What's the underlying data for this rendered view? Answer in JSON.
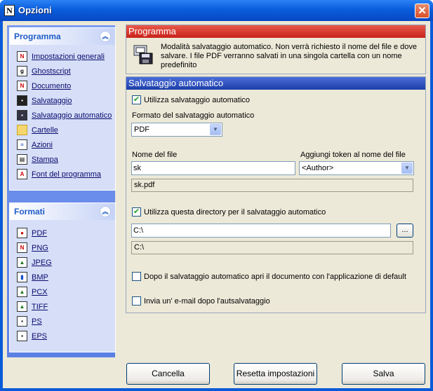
{
  "window": {
    "title": "Opzioni"
  },
  "sidebar": {
    "programma_title": "Programma",
    "programma_items": [
      {
        "label": "Impostazioni generali"
      },
      {
        "label": "Ghostscript"
      },
      {
        "label": "Documento"
      },
      {
        "label": "Salvataggio"
      },
      {
        "label": "Salvataggio automatico"
      },
      {
        "label": "Cartelle"
      },
      {
        "label": "Azioni"
      },
      {
        "label": "Stampa"
      },
      {
        "label": "Font del programma"
      }
    ],
    "formati_title": "Formati",
    "formati_items": [
      {
        "label": "PDF"
      },
      {
        "label": "PNG"
      },
      {
        "label": "JPEG"
      },
      {
        "label": "BMP"
      },
      {
        "label": "PCX"
      },
      {
        "label": "TIFF"
      },
      {
        "label": "PS"
      },
      {
        "label": "EPS"
      }
    ]
  },
  "programma_section": {
    "title": "Programma",
    "description": "Modalità salvataggio automatico. Non verrà richiesto il nome del file e dove salvare. I file PDF verranno salvati in una singola cartella con un nome predefinito"
  },
  "autosave": {
    "title": "Salvataggio automatico",
    "use_autosave_label": "Utilizza salvataggio automatico",
    "use_autosave_checked": true,
    "format_label": "Formato del salvataggio automatico",
    "format_value": "PDF",
    "filename_label": "Nome del file",
    "filename_value": "sk",
    "token_label": "Aggiungi token al nome del file",
    "token_value": "<Author>",
    "filename_preview": "sk.pdf",
    "use_dir_label": "Utilizza questa directory per il salvataggio automatico",
    "use_dir_checked": true,
    "dir_value": "C:\\",
    "browse_label": "...",
    "dir_preview": "C:\\",
    "open_after_label": "Dopo il salvataggio automatico apri il documento con l'applicazione di default",
    "open_after_checked": false,
    "email_label": "Invia un' e-mail dopo l'autsalvataggio",
    "email_checked": false
  },
  "buttons": {
    "cancel_label": "Cancella",
    "reset_label": "Resetta impostazioni",
    "save_label": "Salva"
  }
}
